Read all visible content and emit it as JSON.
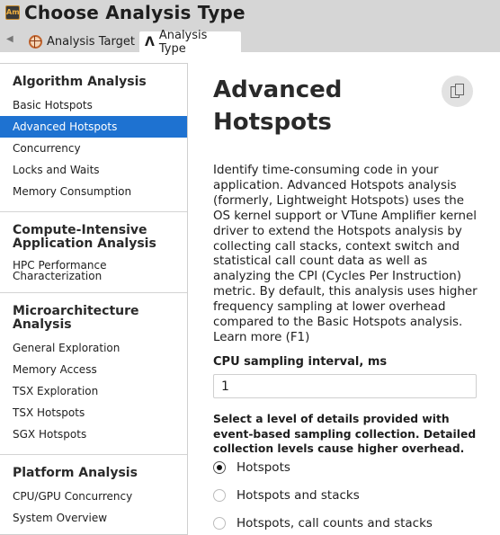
{
  "window": {
    "title": "Choose Analysis Type",
    "app_icon_text": "Am"
  },
  "tabs": [
    {
      "label": "Analysis Target",
      "icon": "target-icon",
      "active": false
    },
    {
      "label": "Analysis Type",
      "icon": "compass-icon",
      "active": true
    }
  ],
  "sidebar": {
    "groups": [
      {
        "heading": "Algorithm Analysis",
        "items": [
          {
            "label": "Basic Hotspots"
          },
          {
            "label": "Advanced Hotspots",
            "selected": true
          },
          {
            "label": "Concurrency"
          },
          {
            "label": "Locks and Waits"
          },
          {
            "label": "Memory Consumption"
          }
        ]
      },
      {
        "heading": "Compute-Intensive Application Analysis",
        "items": [
          {
            "label": "HPC Performance Characterization"
          }
        ]
      },
      {
        "heading": "Microarchitecture Analysis",
        "items": [
          {
            "label": "General Exploration"
          },
          {
            "label": "Memory Access"
          },
          {
            "label": "TSX Exploration"
          },
          {
            "label": "TSX Hotspots"
          },
          {
            "label": "SGX Hotspots"
          }
        ]
      },
      {
        "heading": "Platform Analysis",
        "items": [
          {
            "label": "CPU/GPU Concurrency"
          },
          {
            "label": "System Overview"
          }
        ]
      }
    ]
  },
  "main": {
    "title": "Advanced Hotspots",
    "copy_icon": "copy-icon",
    "description": "Identify time-consuming code in your application. Advanced Hotspots analysis (formerly, Lightweight Hotspots) uses the OS kernel support or VTune Amplifier kernel driver to extend the Hotspots analysis by collecting call stacks, context switch and statistical call count data as well as analyzing the CPI (Cycles Per Instruction) metric. By default, this analysis uses higher frequency sampling at lower overhead compared to the Basic Hotspots analysis. Learn more (F1)",
    "sampling_label": "CPU sampling interval, ms",
    "sampling_value": "1",
    "level_label": "Select a level of details provided with event-based sampling collection. Detailed collection levels cause higher overhead.",
    "levels": [
      {
        "label": "Hotspots",
        "checked": true
      },
      {
        "label": "Hotspots and stacks",
        "checked": false
      },
      {
        "label": "Hotspots, call counts and stacks",
        "checked": false
      }
    ]
  },
  "colors": {
    "selection": "#1e72d1",
    "chrome": "#d6d6d6"
  }
}
